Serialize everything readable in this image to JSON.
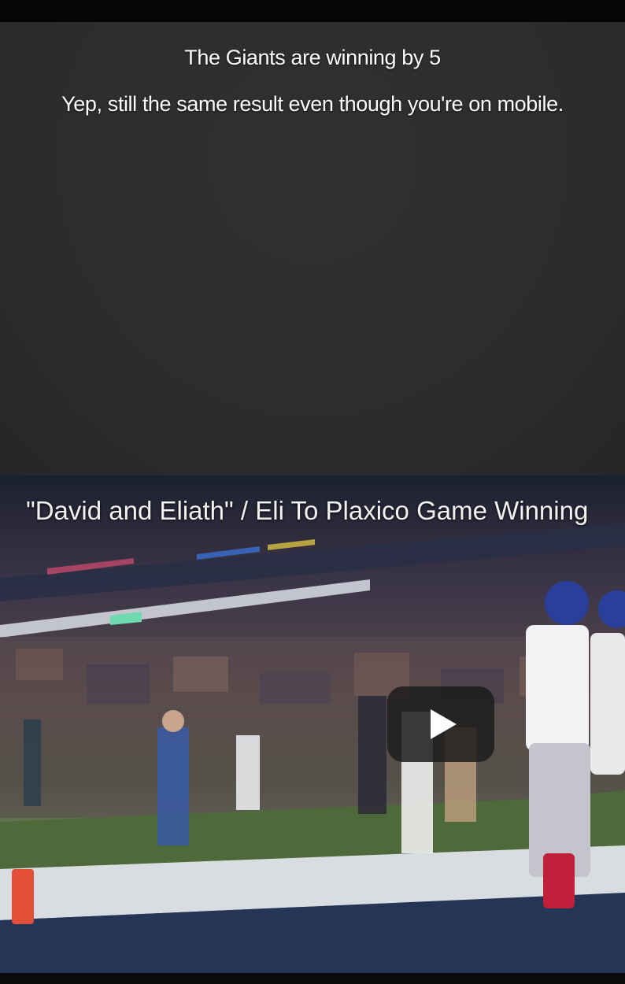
{
  "panel": {
    "headline": "The Giants are winning by 5",
    "subline": "Yep, still the same result even though you're on mobile."
  },
  "video": {
    "title": "\"David and Eliath\" / Eli To Plaxico Game Winning",
    "play_icon": "play-icon"
  }
}
